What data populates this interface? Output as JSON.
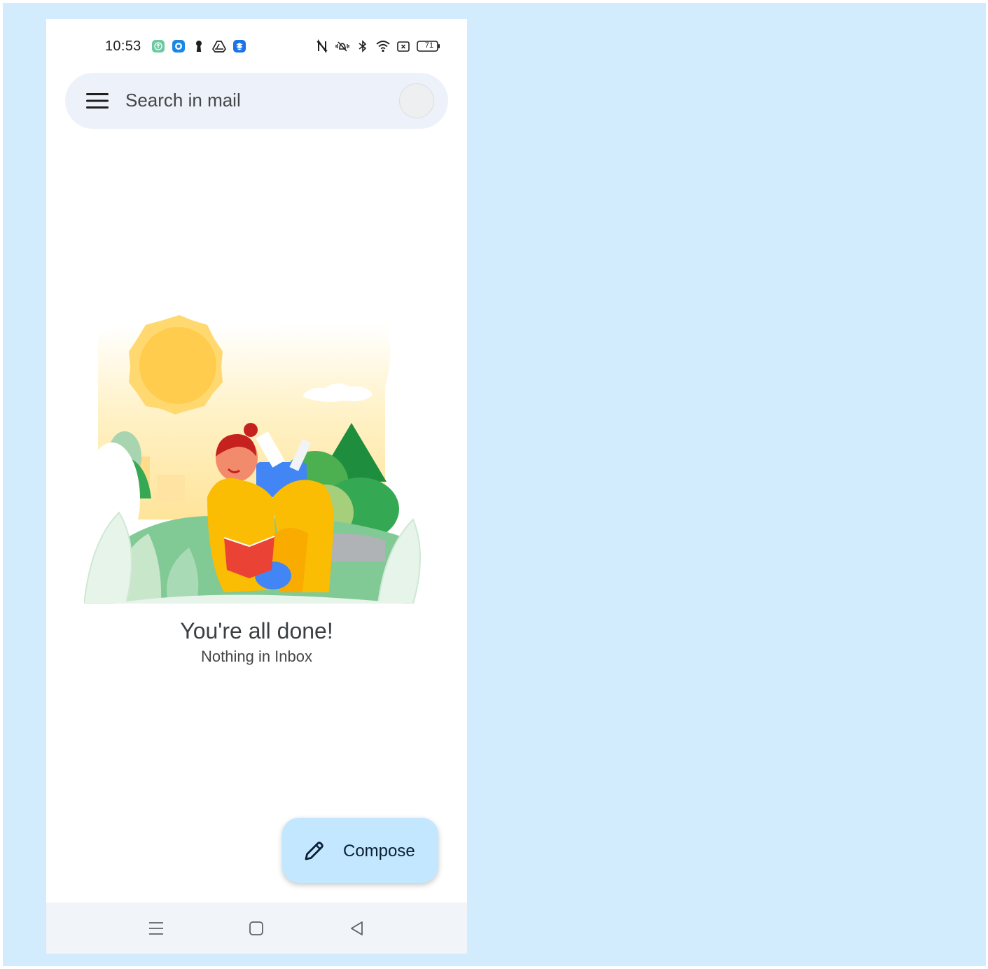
{
  "status_bar": {
    "time": "10:53",
    "battery": "71",
    "left_icons": [
      "app-upload-icon",
      "app-ring-icon",
      "keyhole-icon",
      "drive-icon",
      "dropbox-icon"
    ],
    "right_icons": [
      "nfc-icon",
      "vibrate-mute-icon",
      "bluetooth-icon",
      "wifi-icon",
      "screen-cast-icon",
      "battery-icon"
    ]
  },
  "search": {
    "placeholder": "Search in mail"
  },
  "empty_state": {
    "title": "You're all done!",
    "subtitle": "Nothing in Inbox"
  },
  "compose": {
    "label": "Compose"
  },
  "colors": {
    "backdrop": "#d3ecfd",
    "search_bg": "#edf2fa",
    "fab_bg": "#c2e7ff",
    "nav_bg": "#f1f4f9"
  }
}
